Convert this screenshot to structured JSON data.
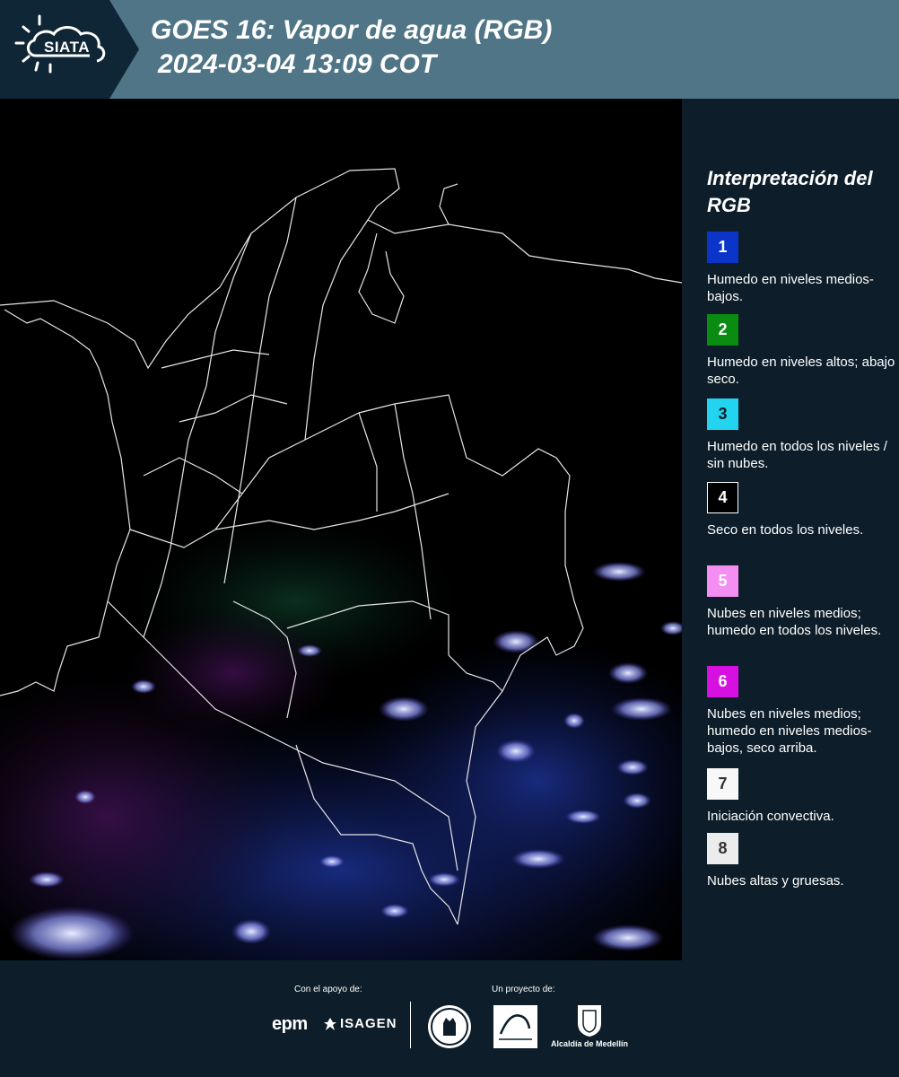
{
  "header": {
    "logo_text": "SIATA",
    "title": "GOES 16: Vapor de agua (RGB)",
    "subtitle": "2024-03-04 13:09 COT",
    "color": "#4f7586"
  },
  "legend": {
    "title": "Interpretación del RGB",
    "items": [
      {
        "number": "1",
        "color": "#0a35c8",
        "text_color": "#ffffff",
        "description": "Humedo en niveles medios-bajos."
      },
      {
        "number": "2",
        "color": "#0a8c12",
        "text_color": "#ffffff",
        "description": "Humedo en niveles altos; abajo seco."
      },
      {
        "number": "3",
        "color": "#22d4f0",
        "text_color": "#0d1e2a",
        "description": "Humedo en todos los niveles / sin nubes."
      },
      {
        "number": "4",
        "color": "#000000",
        "text_color": "#ffffff",
        "description": "Seco en todos los niveles."
      },
      {
        "number": "5",
        "color": "#f58ef2",
        "text_color": "#ffffff",
        "description": "Nubes en niveles medios; humedo en todos los niveles."
      },
      {
        "number": "6",
        "color": "#d610e0",
        "text_color": "#ffffff",
        "description": "Nubes en niveles medios; humedo en niveles medios-bajos, seco arriba."
      },
      {
        "number": "7",
        "color": "#f8f8f8",
        "text_color": "#333333",
        "description": "Iniciación convectiva."
      },
      {
        "number": "8",
        "color": "#ececec",
        "text_color": "#333333",
        "description": "Nubes altas y gruesas."
      }
    ]
  },
  "footer": {
    "support_label": "Con el apoyo de:",
    "project_label": "Un proyecto de:",
    "epm": "epm",
    "isagen": "ISAGEN",
    "alcaldia": "Alcaldía de Medellín"
  }
}
